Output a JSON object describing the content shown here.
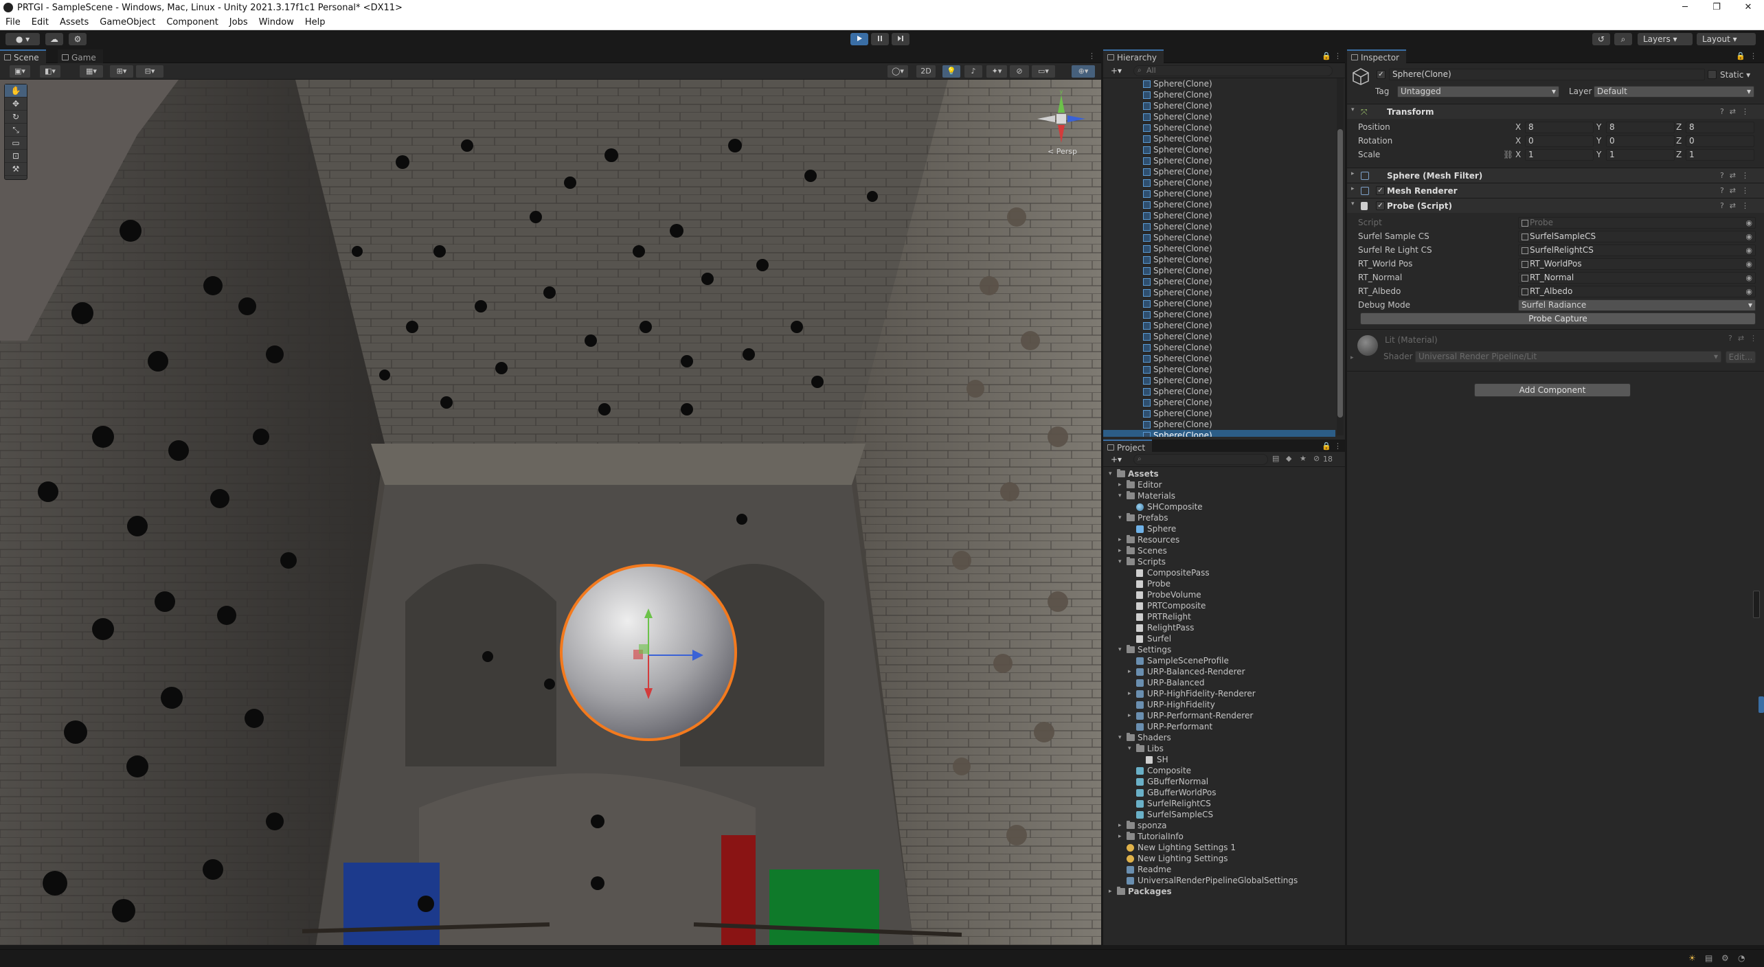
{
  "window": {
    "title": "PRTGI - SampleScene - Windows, Mac, Linux - Unity 2021.3.17f1c1 Personal* <DX11>",
    "controls": [
      "─",
      "❐",
      "✕"
    ]
  },
  "menu": [
    "File",
    "Edit",
    "Assets",
    "GameObject",
    "Component",
    "Jobs",
    "Window",
    "Help"
  ],
  "toolbar": {
    "play_icon": "play-icon",
    "pause_icon": "pause-icon",
    "step_icon": "step-icon",
    "layers_label": "Layers",
    "layout_label": "Layout"
  },
  "scene": {
    "tabs": [
      "Scene",
      "Game"
    ],
    "toolbar_2d_label": "2D",
    "gizmo_label": "< Persp"
  },
  "hierarchy": {
    "tab_label": "Hierarchy",
    "search_placeholder": "All",
    "rows": [
      "Sphere(Clone)",
      "Sphere(Clone)",
      "Sphere(Clone)",
      "Sphere(Clone)",
      "Sphere(Clone)",
      "Sphere(Clone)",
      "Sphere(Clone)",
      "Sphere(Clone)",
      "Sphere(Clone)",
      "Sphere(Clone)",
      "Sphere(Clone)",
      "Sphere(Clone)",
      "Sphere(Clone)",
      "Sphere(Clone)",
      "Sphere(Clone)",
      "Sphere(Clone)",
      "Sphere(Clone)",
      "Sphere(Clone)",
      "Sphere(Clone)",
      "Sphere(Clone)",
      "Sphere(Clone)",
      "Sphere(Clone)",
      "Sphere(Clone)",
      "Sphere(Clone)",
      "Sphere(Clone)",
      "Sphere(Clone)",
      "Sphere(Clone)",
      "Sphere(Clone)",
      "Sphere(Clone)",
      "Sphere(Clone)",
      "Sphere(Clone)",
      "Sphere(Clone)",
      "Sphere(Clone)"
    ]
  },
  "project": {
    "tab_label": "Project",
    "visible_count": "18",
    "tree": [
      {
        "label": "Assets",
        "depth": 0,
        "arrow": "▾",
        "icon": "folder",
        "bold": true
      },
      {
        "label": "Editor",
        "depth": 1,
        "arrow": "▸",
        "icon": "folder"
      },
      {
        "label": "Materials",
        "depth": 1,
        "arrow": "▾",
        "icon": "folder"
      },
      {
        "label": "SHComposite",
        "depth": 2,
        "arrow": "",
        "icon": "material"
      },
      {
        "label": "Prefabs",
        "depth": 1,
        "arrow": "▾",
        "icon": "folder"
      },
      {
        "label": "Sphere",
        "depth": 2,
        "arrow": "",
        "icon": "prefab"
      },
      {
        "label": "Resources",
        "depth": 1,
        "arrow": "▸",
        "icon": "folder"
      },
      {
        "label": "Scenes",
        "depth": 1,
        "arrow": "▸",
        "icon": "folder"
      },
      {
        "label": "Scripts",
        "depth": 1,
        "arrow": "▾",
        "icon": "folder"
      },
      {
        "label": "CompositePass",
        "depth": 2,
        "arrow": "",
        "icon": "script"
      },
      {
        "label": "Probe",
        "depth": 2,
        "arrow": "",
        "icon": "script"
      },
      {
        "label": "ProbeVolume",
        "depth": 2,
        "arrow": "",
        "icon": "script"
      },
      {
        "label": "PRTComposite",
        "depth": 2,
        "arrow": "",
        "icon": "script"
      },
      {
        "label": "PRTRelight",
        "depth": 2,
        "arrow": "",
        "icon": "script"
      },
      {
        "label": "RelightPass",
        "depth": 2,
        "arrow": "",
        "icon": "script"
      },
      {
        "label": "Surfel",
        "depth": 2,
        "arrow": "",
        "icon": "script"
      },
      {
        "label": "Settings",
        "depth": 1,
        "arrow": "▾",
        "icon": "folder"
      },
      {
        "label": "SampleSceneProfile",
        "depth": 2,
        "arrow": "",
        "icon": "asset"
      },
      {
        "label": "URP-Balanced-Renderer",
        "depth": 2,
        "arrow": "▸",
        "icon": "asset"
      },
      {
        "label": "URP-Balanced",
        "depth": 2,
        "arrow": "",
        "icon": "asset"
      },
      {
        "label": "URP-HighFidelity-Renderer",
        "depth": 2,
        "arrow": "▸",
        "icon": "asset"
      },
      {
        "label": "URP-HighFidelity",
        "depth": 2,
        "arrow": "",
        "icon": "asset"
      },
      {
        "label": "URP-Performant-Renderer",
        "depth": 2,
        "arrow": "▸",
        "icon": "asset"
      },
      {
        "label": "URP-Performant",
        "depth": 2,
        "arrow": "",
        "icon": "asset"
      },
      {
        "label": "Shaders",
        "depth": 1,
        "arrow": "▾",
        "icon": "folder"
      },
      {
        "label": "Libs",
        "depth": 2,
        "arrow": "▾",
        "icon": "folder"
      },
      {
        "label": "SH",
        "depth": 3,
        "arrow": "",
        "icon": "script"
      },
      {
        "label": "Composite",
        "depth": 2,
        "arrow": "",
        "icon": "shader"
      },
      {
        "label": "GBufferNormal",
        "depth": 2,
        "arrow": "",
        "icon": "shader"
      },
      {
        "label": "GBufferWorldPos",
        "depth": 2,
        "arrow": "",
        "icon": "shader"
      },
      {
        "label": "SurfelRelightCS",
        "depth": 2,
        "arrow": "",
        "icon": "shader"
      },
      {
        "label": "SurfelSampleCS",
        "depth": 2,
        "arrow": "",
        "icon": "shader"
      },
      {
        "label": "sponza",
        "depth": 1,
        "arrow": "▸",
        "icon": "folder"
      },
      {
        "label": "TutorialInfo",
        "depth": 1,
        "arrow": "▸",
        "icon": "folder"
      },
      {
        "label": "New Lighting Settings 1",
        "depth": 1,
        "arrow": "",
        "icon": "light"
      },
      {
        "label": "New Lighting Settings",
        "depth": 1,
        "arrow": "",
        "icon": "light"
      },
      {
        "label": "Readme",
        "depth": 1,
        "arrow": "",
        "icon": "asset"
      },
      {
        "label": "UniversalRenderPipelineGlobalSettings",
        "depth": 1,
        "arrow": "",
        "icon": "asset"
      },
      {
        "label": "Packages",
        "depth": 0,
        "arrow": "▸",
        "icon": "folder",
        "bold": true
      }
    ]
  },
  "inspector": {
    "tab_label": "Inspector",
    "object_name": "Sphere(Clone)",
    "static_label": "Static",
    "tag_label": "Tag",
    "tag_value": "Untagged",
    "layer_label": "Layer",
    "layer_value": "Default",
    "transform": {
      "title": "Transform",
      "rows": [
        {
          "label": "Position",
          "x": "8",
          "y": "8",
          "z": "8"
        },
        {
          "label": "Rotation",
          "x": "0",
          "y": "0",
          "z": "0"
        },
        {
          "label": "Scale",
          "x": "1",
          "y": "1",
          "z": "1"
        }
      ]
    },
    "mesh_filter_title": "Sphere (Mesh Filter)",
    "mesh_renderer_title": "Mesh Renderer",
    "probe": {
      "title": "Probe (Script)",
      "fields": [
        {
          "label": "Script",
          "value": "Probe",
          "disabled": true
        },
        {
          "label": "Surfel Sample CS",
          "value": "SurfelSampleCS"
        },
        {
          "label": "Surfel Re Light CS",
          "value": "SurfelRelightCS"
        },
        {
          "label": "RT_World Pos",
          "value": "RT_WorldPos"
        },
        {
          "label": "RT_Normal",
          "value": "RT_Normal"
        },
        {
          "label": "RT_Albedo",
          "value": "RT_Albedo"
        }
      ],
      "debug_mode_label": "Debug Mode",
      "debug_mode_value": "Surfel Radiance",
      "capture_button": "Probe Capture"
    },
    "material": {
      "title": "Lit (Material)",
      "shader_label": "Shader",
      "shader_value": "Universal Render Pipeline/Lit",
      "edit_label": "Edit..."
    },
    "add_component": "Add Component"
  },
  "colors": {
    "accent": "#3a6ea5",
    "selection": "#2c5d87",
    "panel": "#282828",
    "selected_outline": "#f37a1e"
  }
}
